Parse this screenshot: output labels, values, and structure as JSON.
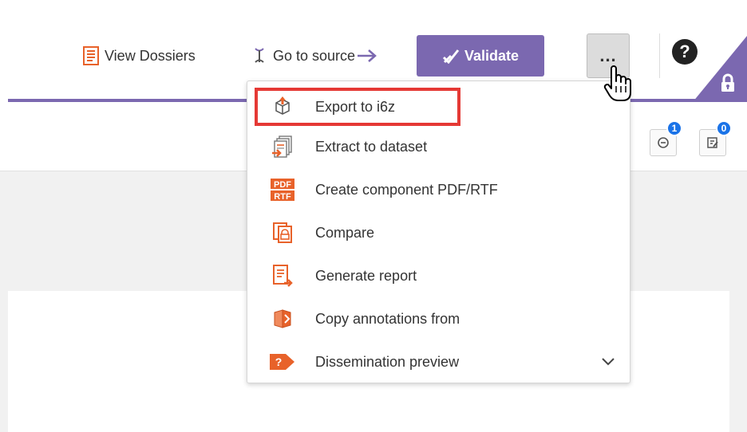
{
  "header": {
    "view_dossiers": "View Dossiers",
    "go_to_source": "Go to source",
    "validate": "Validate",
    "more": "...",
    "help": "?"
  },
  "toolbar": {
    "badge_history": "1",
    "badge_notes": "0"
  },
  "menu": {
    "items": [
      {
        "label": "Export to i6z",
        "icon": "export-i6z-icon"
      },
      {
        "label": "Extract to dataset",
        "icon": "extract-dataset-icon"
      },
      {
        "label": "Create component PDF/RTF",
        "icon": "pdf-rtf-icon"
      },
      {
        "label": "Compare",
        "icon": "compare-icon"
      },
      {
        "label": "Generate report",
        "icon": "report-icon"
      },
      {
        "label": "Copy annotations from",
        "icon": "copy-annotations-icon"
      },
      {
        "label": "Dissemination preview",
        "icon": "dissemination-icon"
      }
    ],
    "pdf_icon_text_top": "PDF",
    "pdf_icon_text_bottom": "RTF",
    "dissemination_icon_text": "?"
  },
  "colors": {
    "accent_purple": "#7b68b0",
    "icon_orange": "#e8622a",
    "highlight_red": "#e53935",
    "badge_blue": "#1a73e8"
  }
}
